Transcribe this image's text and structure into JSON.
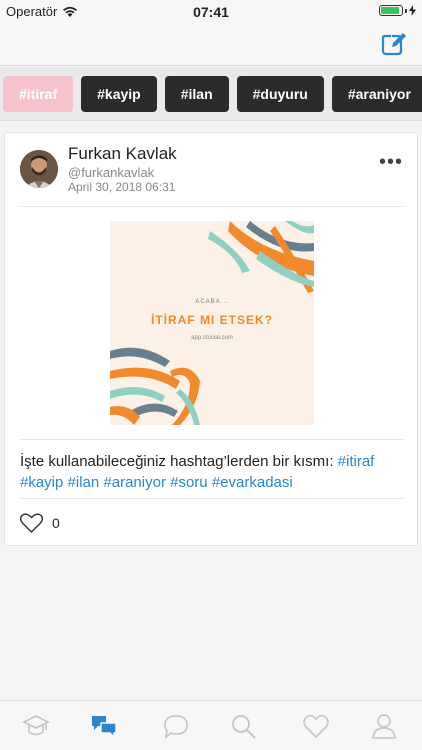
{
  "status_bar": {
    "carrier": "Operatör",
    "time": "07:41",
    "battery_level": 0.92
  },
  "tags": [
    {
      "label": "#itiraf",
      "active": true
    },
    {
      "label": "#kayip"
    },
    {
      "label": "#ilan"
    },
    {
      "label": "#duyuru"
    },
    {
      "label": "#araniyor"
    },
    {
      "label": "",
      "partial": true
    }
  ],
  "post": {
    "author": "Furkan Kavlak",
    "handle": "@furkankavlak",
    "date": "April 30, 2018 06:31",
    "image": {
      "line1": "ACABA...",
      "line2": "İTİRAF MI ETSEK?",
      "line3": "app.stucial.com"
    },
    "text_prefix": "İşte kullanabileceğiniz hashtag’lerden bir kısmı: ",
    "hashtags": [
      "#itiraf",
      "#kayip",
      "#ilan",
      "#araniyor",
      "#soru",
      "#evarkadasi"
    ],
    "like_count": "0"
  },
  "icons": {
    "compose": "compose-icon",
    "more": "more-icon",
    "like": "heart-outline-icon",
    "wifi": "wifi-icon",
    "battery": "battery-icon"
  },
  "tab_bar": [
    {
      "name": "tab-school",
      "icon": "graduation-cap-icon",
      "active": false
    },
    {
      "name": "tab-feed",
      "icon": "chat-bubbles-icon",
      "active": true
    },
    {
      "name": "tab-messages",
      "icon": "chat-bubble-icon",
      "active": false
    },
    {
      "name": "tab-search",
      "icon": "search-icon",
      "active": false
    },
    {
      "name": "tab-favorites",
      "icon": "heart-icon",
      "active": false
    },
    {
      "name": "tab-profile",
      "icon": "user-icon",
      "active": false
    }
  ],
  "colors": {
    "accent": "#2a86d1",
    "active_tag": "#f6c2cc",
    "tag_bg": "#2b2b2b",
    "inactive_icon": "#c4c4c4"
  }
}
